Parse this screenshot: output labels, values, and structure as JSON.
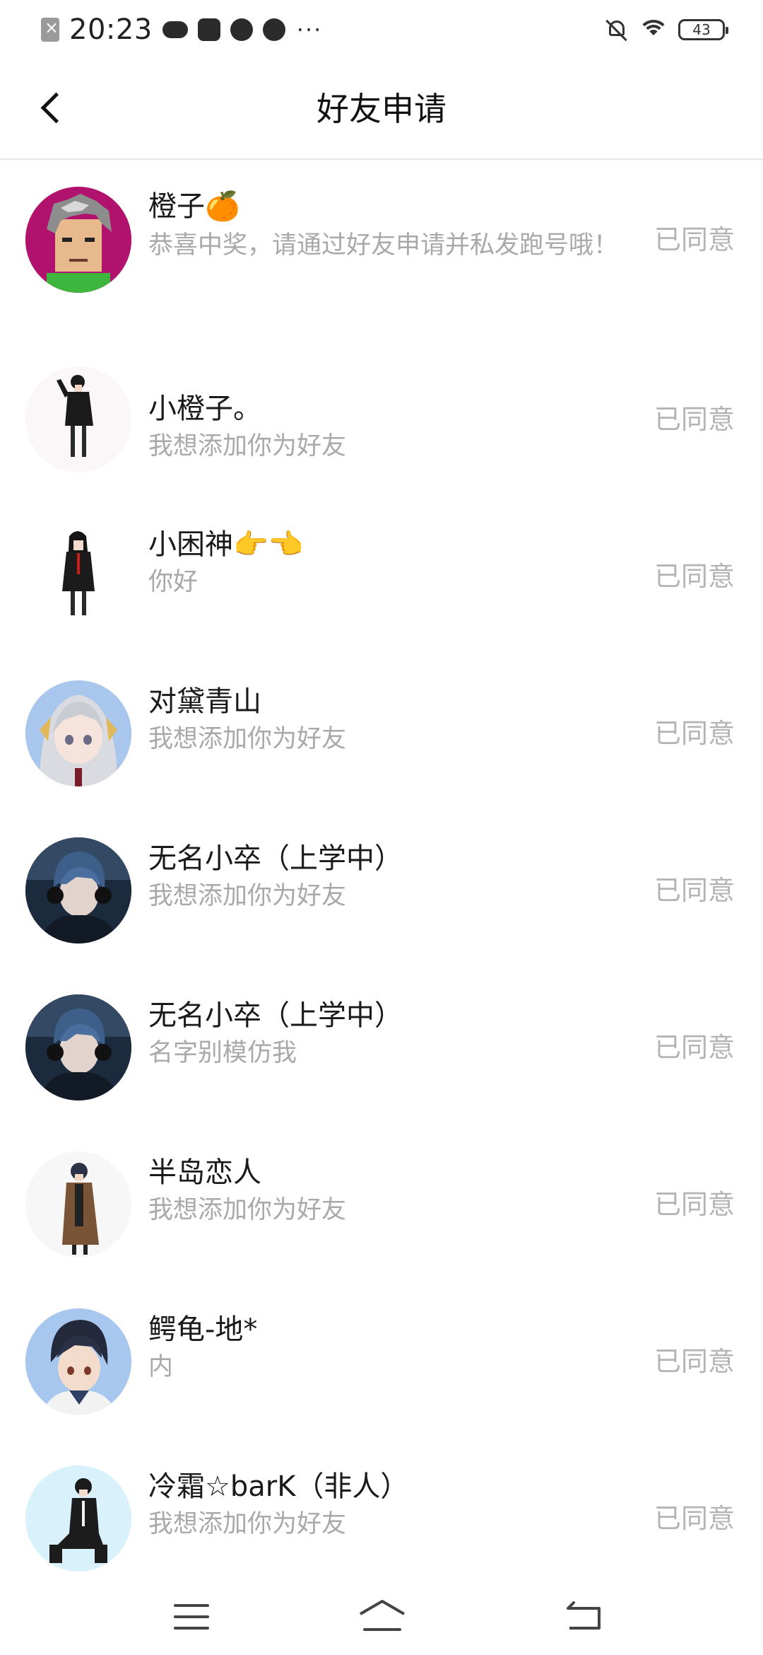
{
  "status_bar": {
    "time": "20:23",
    "battery": "43",
    "left_icons": [
      "sim-off-icon",
      "cloud-icon",
      "music-icon",
      "cat-icon",
      "compass-icon"
    ],
    "overflow": "···"
  },
  "header": {
    "title": "好友申请",
    "back_icon": "chevron-left-icon"
  },
  "requests": [
    {
      "name": "橙子🍊",
      "message": "恭喜中奖，请通过好友申请并私发跑号哦！",
      "status": "已同意",
      "avatar": "pixel-gray-hair-avatar"
    },
    {
      "name": "小橙子。",
      "message": "我想添加你为好友",
      "status": "已同意",
      "avatar": "anime-girl-black-dress-avatar"
    },
    {
      "name": "小困神👉👈",
      "message": "你好",
      "status": "已同意",
      "avatar": "anime-girl-red-tie-avatar"
    },
    {
      "name": "对黛青山",
      "message": "我想添加你为好友",
      "status": "已同意",
      "avatar": "anime-silver-hair-girl-avatar"
    },
    {
      "name": "无名小卒（上学中）",
      "message": "我想添加你为好友",
      "status": "已同意",
      "avatar": "anime-blue-hair-headphones-avatar"
    },
    {
      "name": "无名小卒（上学中）",
      "message": "名字别模仿我",
      "status": "已同意",
      "avatar": "anime-blue-hair-headphones-avatar"
    },
    {
      "name": "半岛恋人",
      "message": "我想添加你为好友",
      "status": "已同意",
      "avatar": "anime-brown-coat-boy-avatar"
    },
    {
      "name": "鳄龟-地*",
      "message": "内",
      "status": "已同意",
      "avatar": "anime-dark-hair-boy-avatar"
    },
    {
      "name": "冷霜☆barK（非人）",
      "message": "我想添加你为好友",
      "status": "已同意",
      "avatar": "anime-sitting-boy-avatar"
    }
  ],
  "nav_bar": {
    "icons": [
      "menu-icon",
      "home-icon",
      "back-icon"
    ]
  }
}
